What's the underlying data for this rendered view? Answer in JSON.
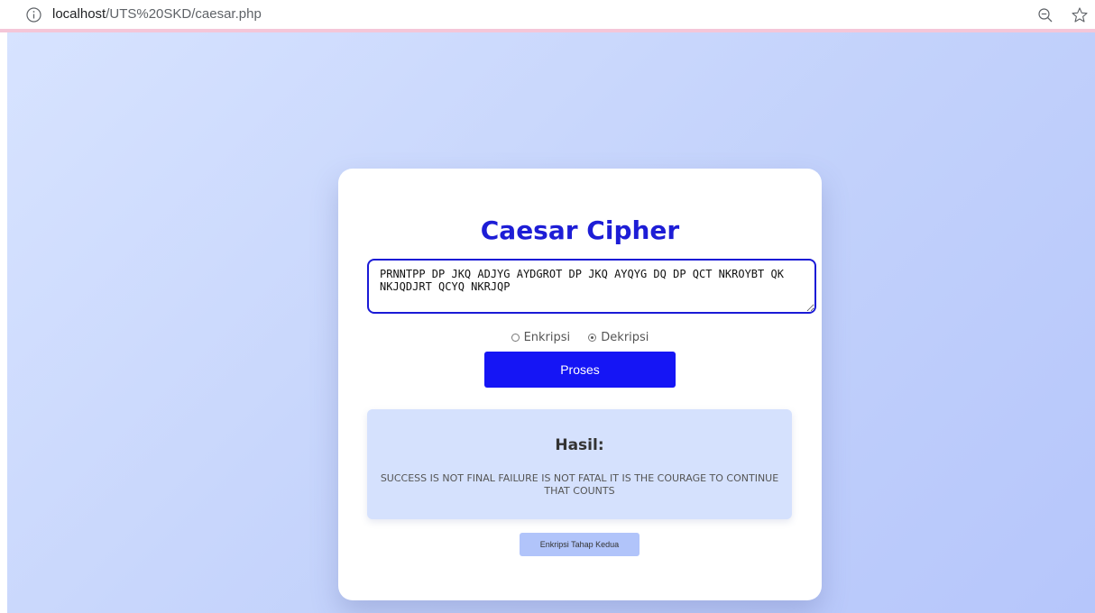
{
  "browser": {
    "url_host": "localhost",
    "url_path": "/UTS%20SKD/caesar.php"
  },
  "page": {
    "title": "Caesar Cipher",
    "input_text": "PRNNTPP DP JKQ ADJYG AYDGROT DP JKQ AYQYG DQ DP QCT NKROYBT QK NKJQDJRT QCYQ NKRJQP",
    "options": {
      "encrypt_label": "Enkripsi",
      "decrypt_label": "Dekripsi",
      "selected": "Dekripsi"
    },
    "process_button_label": "Proses",
    "result": {
      "heading": "Hasil:",
      "text": "SUCCESS IS NOT FINAL FAILURE IS NOT FATAL IT IS THE COURAGE TO CONTINUE THAT COUNTS"
    },
    "second_stage_button_label": "Enkripsi Tahap Kedua"
  },
  "colors": {
    "accent": "#1515f5",
    "title": "#1d1dd6",
    "result_bg": "#d5e1fd",
    "secondary_button": "#b1c4fa"
  },
  "icons": {
    "address_info": "info-icon",
    "zoom": "zoom-out-icon",
    "bookmark": "star-icon"
  }
}
